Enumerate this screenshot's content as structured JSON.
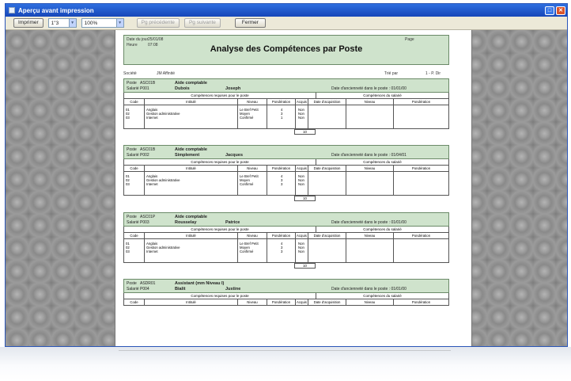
{
  "window": {
    "title": "Aperçu avant impression"
  },
  "toolbar": {
    "print_label": "Imprimer",
    "page_value": "1\"3",
    "zoom_value": "100%",
    "prev_label": "Pg précédente",
    "next_label": "Pg suivante",
    "close_label": "Fermer"
  },
  "report": {
    "title": "Analyse des Compétences par Poste",
    "date_label": "Date du jour",
    "date_value": "25/01/08",
    "time_label": "Heure",
    "time_value": "07:08",
    "page_label": "Page",
    "company_label": "Société",
    "company_value": "JM Affinité",
    "sort_label": "Trié par",
    "sort_value": "1 - P. Dir"
  },
  "table_headers": {
    "left_group": "Compétences requises pour le poste",
    "right_group": "Compétences du salarié",
    "columns": [
      "Code",
      "Intitulé",
      "Niveau",
      "Pondération",
      "Acquis",
      "Date d'acquisition",
      "Niveau",
      "Pondération"
    ]
  },
  "blocks": [
    {
      "poste_label": "Poste",
      "poste_code": "ASC01B",
      "salarie_label": "Salarié",
      "salarie_code": "P001",
      "job_title": "Aide comptable",
      "last_name": "Dubois",
      "first_name": "Joseph",
      "date_text": "Date d'ancienneté dans le poste : 01/01/00",
      "codes": "01\n02\n03",
      "intitules": "Anglais\nGestion administrative\nInternet",
      "niveaux": "Le Bref Petit\nMoyen\nConfirmé",
      "ponderations": "4\n3\n1",
      "acquis": "Non\nNon\nNon",
      "total": "10"
    },
    {
      "poste_label": "Poste",
      "poste_code": "ASC01B",
      "salarie_label": "Salarié",
      "salarie_code": "P002",
      "job_title": "Aide comptable",
      "last_name": "Simplement",
      "first_name": "Jacques",
      "date_text": "Date d'ancienneté dans le poste : 01/04/01",
      "codes": "01\n02\n03",
      "intitules": "Anglais\nGestion administrative\nInternet",
      "niveaux": "Le Bref Petit\nMoyen\nConfirmé",
      "ponderations": "4\n3\n3",
      "acquis": "Non\nNon\nNon",
      "total": "10"
    },
    {
      "poste_label": "Poste",
      "poste_code": "ASC01P",
      "salarie_label": "Salarié",
      "salarie_code": "P003",
      "job_title": "Aide comptable",
      "last_name": "Rousselay",
      "first_name": "Patrice",
      "date_text": "Date d'ancienneté dans le poste : 01/01/00",
      "codes": "01\n02\n03",
      "intitules": "Anglais\nGestion administrative\nInternet",
      "niveaux": "Le Bref Petit\nMoyen\nConfirmé",
      "ponderations": "4\n3\n3",
      "acquis": "Non\nNon\nNon",
      "total": "10"
    },
    {
      "poste_label": "Poste",
      "poste_code": "ASDR01",
      "salarie_label": "Salarié",
      "salarie_code": "P004",
      "job_title": "Assistant (mm Niveau I)",
      "last_name": "Bialit",
      "first_name": "Justine",
      "date_text": "Date d'ancienneté dans le poste : 01/01/00"
    }
  ]
}
